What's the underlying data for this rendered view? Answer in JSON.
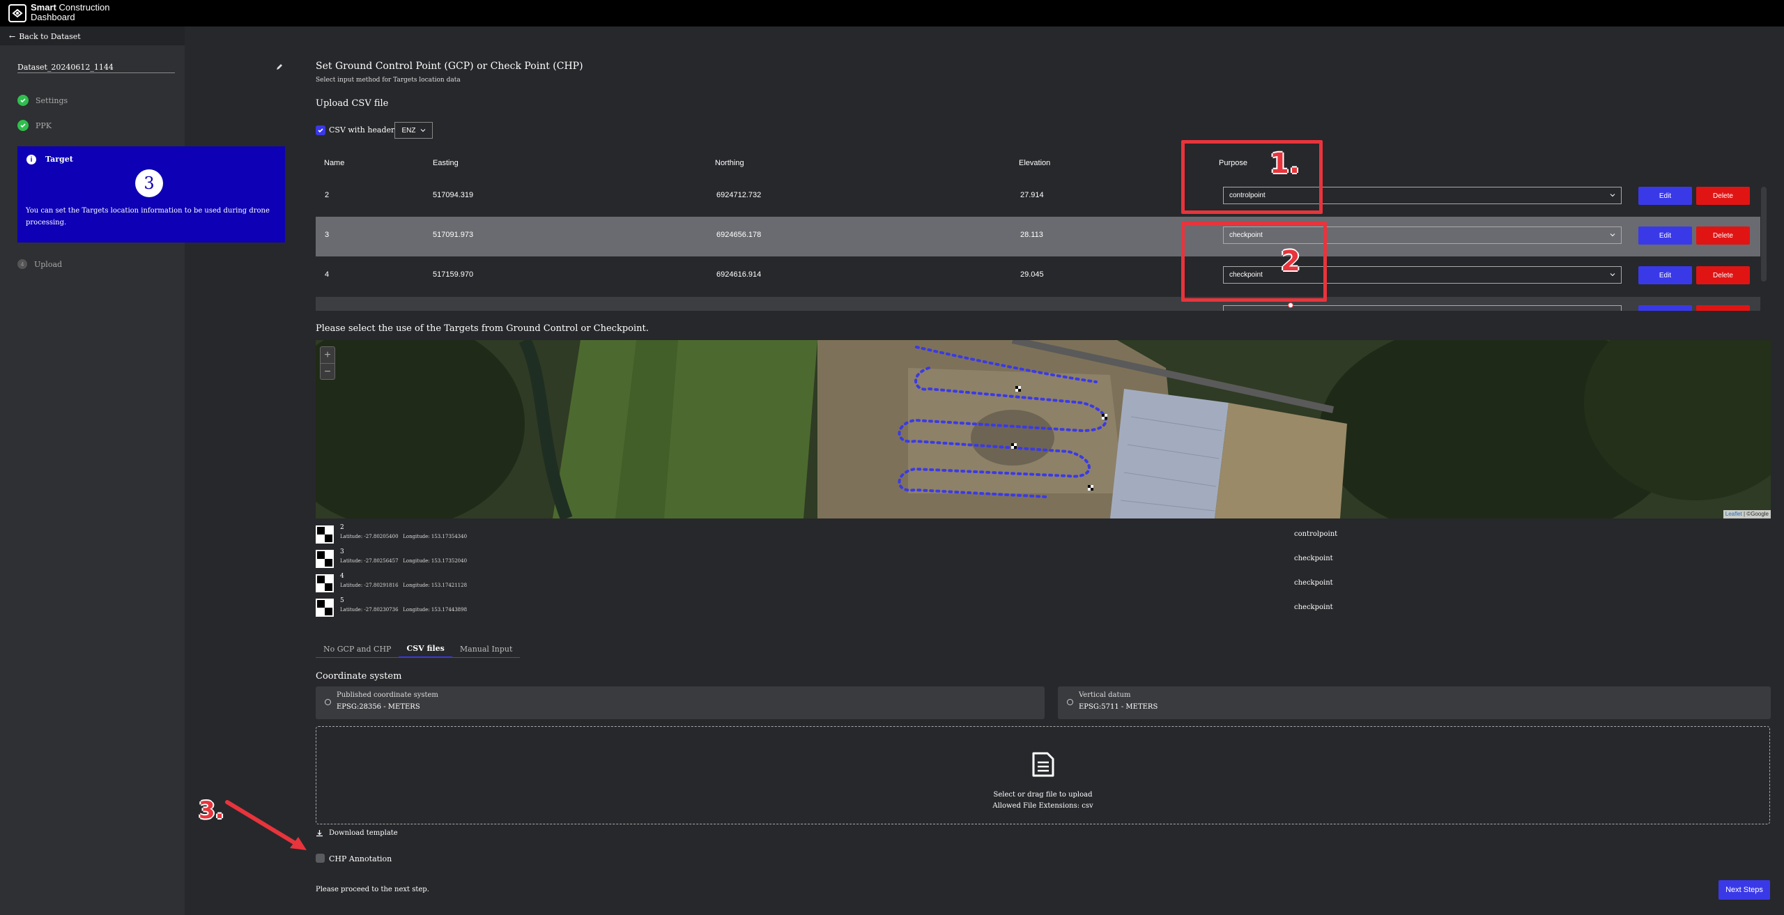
{
  "brand": {
    "bold": "Smart",
    "rest": " Construction",
    "line2": "Dashboard"
  },
  "sidebar": {
    "back_label": "Back to Dataset",
    "dataset_name": "Dataset_20240612_1144",
    "steps": {
      "settings": "Settings",
      "ppk": "PPK",
      "target": {
        "title": "Target",
        "number": "3",
        "description": "You can set the Targets location information to be used during drone processing."
      },
      "upload": "Upload"
    }
  },
  "main": {
    "title": "Set Ground Control Point (GCP) or Check Point (CHP)",
    "subtitle": "Select input method for Targets location data",
    "upload_title": "Upload CSV file",
    "csv_header_label": "CSV with header",
    "format_value": "ENZ",
    "table": {
      "headers": {
        "name": "Name",
        "easting": "Easting",
        "northing": "Northing",
        "elevation": "Elevation",
        "purpose": "Purpose"
      },
      "rows": [
        {
          "name": "2",
          "easting": "517094.319",
          "northing": "6924712.732",
          "elevation": "27.914",
          "purpose": "controlpoint"
        },
        {
          "name": "3",
          "easting": "517091.973",
          "northing": "6924656.178",
          "elevation": "28.113",
          "purpose": "checkpoint"
        },
        {
          "name": "4",
          "easting": "517159.970",
          "northing": "6924616.914",
          "elevation": "29.045",
          "purpose": "checkpoint"
        }
      ],
      "edit_label": "Edit",
      "delete_label": "Delete"
    },
    "annotations": {
      "one": "1.",
      "two": "2",
      "three": "3."
    },
    "map_caption": "Please select the use of the Targets from Ground Control or Checkpoint.",
    "map": {
      "zoom_in": "+",
      "zoom_out": "−",
      "attribution_link": "Leaflet",
      "attribution_rest": " | ©Google"
    },
    "targets": [
      {
        "name": "2",
        "coords": "Latitude: -27.80205400   Longitude: 153.17354340",
        "purpose": "controlpoint"
      },
      {
        "name": "3",
        "coords": "Latitude: -27.80256457   Longitude: 153.17352040",
        "purpose": "checkpoint"
      },
      {
        "name": "4",
        "coords": "Latitude: -27.80291816   Longitude: 153.17421128",
        "purpose": "checkpoint"
      },
      {
        "name": "5",
        "coords": "Latitude: -27.80230736   Longitude: 153.17443898",
        "purpose": "checkpoint"
      }
    ],
    "tabs": [
      "No GCP and CHP",
      "CSV files",
      "Manual Input"
    ],
    "coord_title": "Coordinate system",
    "coord_system": {
      "label": "Published coordinate system",
      "value": "EPSG:28356 - METERS"
    },
    "vertical_datum": {
      "label": "Vertical datum",
      "value": "EPSG:5711 - METERS"
    },
    "dropzone": {
      "line1": "Select or drag file to upload",
      "line2": "Allowed File Extensions: csv"
    },
    "download_template": "Download template",
    "chp_annotation": "CHP Annotation",
    "proceed_text": "Please proceed to the next step.",
    "next_button": "Next Steps"
  },
  "colors": {
    "accent": "#3a39e8",
    "danger": "#e11414",
    "success": "#2fbf4d",
    "annotation": "#e8343c",
    "target_box": "#0d00b5"
  }
}
